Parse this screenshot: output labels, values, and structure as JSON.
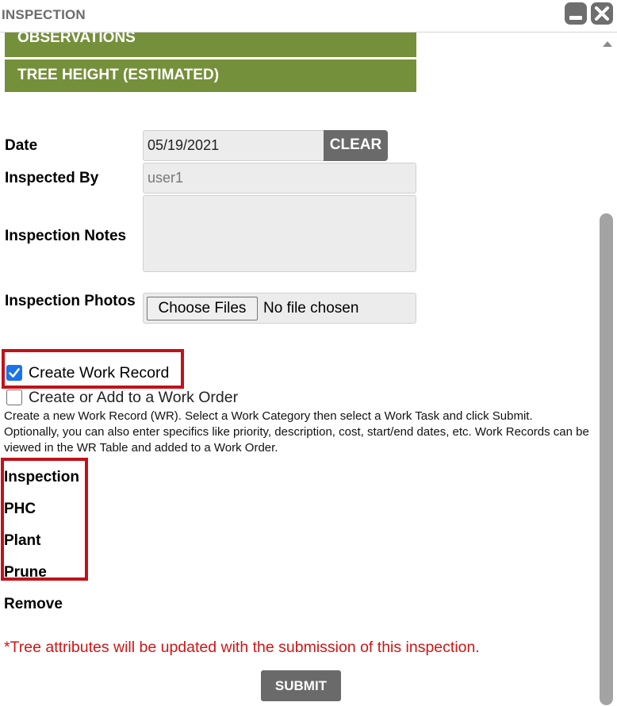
{
  "window": {
    "title": "INSPECTION"
  },
  "sections": {
    "observations": "OBSERVATIONS",
    "tree_height": "TREE HEIGHT (ESTIMATED)"
  },
  "form": {
    "date_label": "Date",
    "date_value": "05/19/2021",
    "clear_label": "CLEAR",
    "inspected_by_label": "Inspected By",
    "inspected_by_value": "user1",
    "notes_label": "Inspection Notes",
    "photos_label": "Inspection Photos",
    "choose_files_label": "Choose Files",
    "no_file_text": "No file chosen"
  },
  "options": {
    "create_work_record": "Create Work Record",
    "create_work_order": "Create or Add to a Work Order"
  },
  "help_text": "Create a new Work Record (WR). Select a Work Category then select a Work Task and click Submit. Optionally, you can also enter specifics like priority, description, cost, start/end dates, etc. Work Records can be viewed in the WR Table and added to a Work Order.",
  "categories": [
    "Inspection",
    "PHC",
    "Plant",
    "Prune",
    "Remove"
  ],
  "notice": "*Tree attributes will be updated with the submission of this inspection.",
  "submit_label": "SUBMIT",
  "colors": {
    "section_bg": "#75903a",
    "highlight": "#c1121a",
    "notice": "#d01515",
    "checkbox": "#1a73e8"
  }
}
